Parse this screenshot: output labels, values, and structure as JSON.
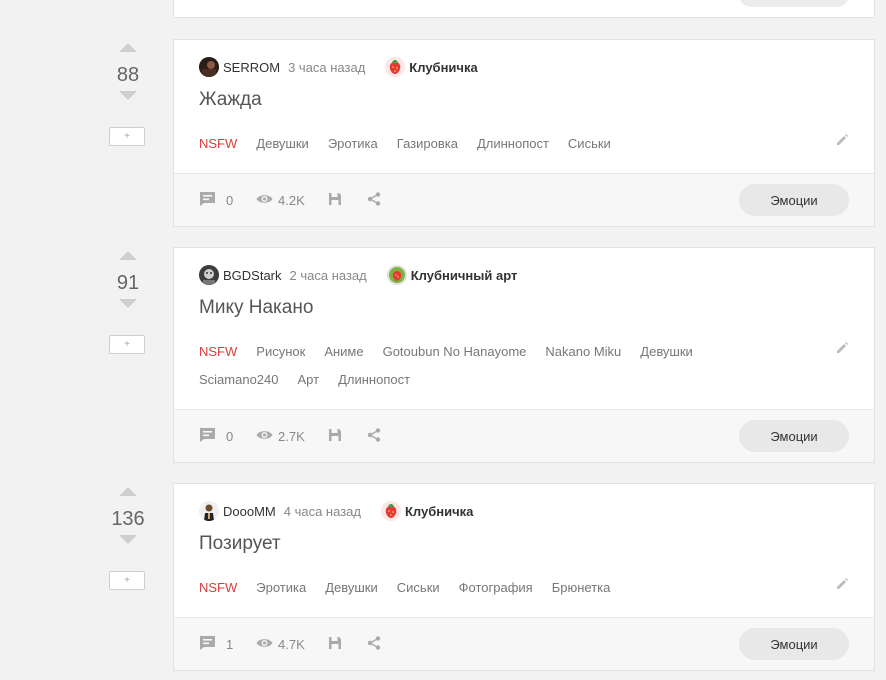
{
  "posts": [
    {
      "votes": "88",
      "author": "SERROM",
      "time": "3 часа назад",
      "community": "Клубничка",
      "title": "Жажда",
      "tags": [
        "NSFW",
        "Девушки",
        "Эротика",
        "Газировка",
        "Длиннопост",
        "Сиськи"
      ],
      "comments": "0",
      "views": "4.2K",
      "emotions_label": "Эмоции"
    },
    {
      "votes": "91",
      "author": "BGDStark",
      "time": "2 часа назад",
      "community": "Клубничный арт",
      "title": "Мику Накано",
      "tags": [
        "NSFW",
        "Рисунок",
        "Аниме",
        "Gotoubun No Hanayome",
        "Nakano Miku",
        "Девушки",
        "Sciamano240",
        "Арт",
        "Длиннопост"
      ],
      "comments": "0",
      "views": "2.7K",
      "emotions_label": "Эмоции"
    },
    {
      "votes": "136",
      "author": "DoooMM",
      "time": "4 часа назад",
      "community": "Клубничка",
      "title": "Позирует",
      "tags": [
        "NSFW",
        "Эротика",
        "Девушки",
        "Сиськи",
        "Фотография",
        "Брюнетка"
      ],
      "comments": "1",
      "views": "4.7K",
      "emotions_label": "Эмоции"
    }
  ],
  "colors": {
    "nsfw_tag": "#d83d3d",
    "page_bg": "#f2f2f2",
    "card_bg": "#ffffff",
    "footer_bg": "#f7f7f7",
    "button_bg": "#e8e8e8"
  },
  "icons": {
    "comment": "comment-icon",
    "views": "eye-icon",
    "save": "save-icon",
    "share": "share-icon",
    "edit": "pencil-icon",
    "vote_up": "arrow-up-icon",
    "vote_down": "arrow-down-icon",
    "add": "plus-icon"
  }
}
